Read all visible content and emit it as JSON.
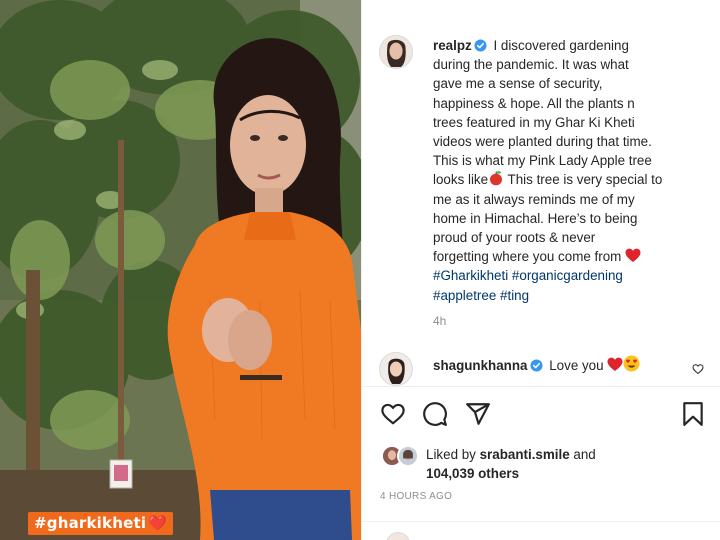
{
  "media": {
    "overlay_tag": "#gharkikheti",
    "overlay_heart": "❤️"
  },
  "post": {
    "author": "realpz",
    "caption_lines": [
      "I discovered gardening",
      "during the pandemic. It was what",
      "gave me a sense of security,",
      "happiness & hope. All the plants n",
      "trees featured in my Ghar Ki Kheti",
      "videos were planted during that time.",
      "This is what my Pink Lady Apple tree",
      "looks like",
      " This tree is very special to",
      "me as it always reminds me of my",
      "home in Himachal. Here’s to being",
      "proud of your roots & never",
      "forgetting where you come from",
      "#Gharkikheti",
      "#organicgardening",
      "#appletree",
      "#ting"
    ],
    "caption_time": "4h",
    "comment": {
      "user": "shagunkhanna",
      "text": "Love you"
    },
    "liked_by_prefix": "Liked by",
    "liked_by_user": "srabanti.smile",
    "liked_by_and": "and",
    "likes_count": "104,039 others",
    "date": "4 HOURS AGO"
  },
  "icons": {
    "verified": "verified-badge-icon",
    "like": "heart-outline-icon",
    "comment": "comment-bubble-icon",
    "share": "paper-plane-icon",
    "save": "bookmark-icon",
    "apple_emoji": "apple-emoji-icon",
    "red_heart_emoji": "red-heart-emoji-icon",
    "heart_eyes_emoji": "heart-eyes-emoji-icon"
  },
  "colors": {
    "verified_blue": "#3897f0",
    "hashtag_blue": "#00376b",
    "muted_gray": "#8e8e8e",
    "tag_orange": "#f06a1d",
    "sweater_orange": "#f07a24"
  }
}
